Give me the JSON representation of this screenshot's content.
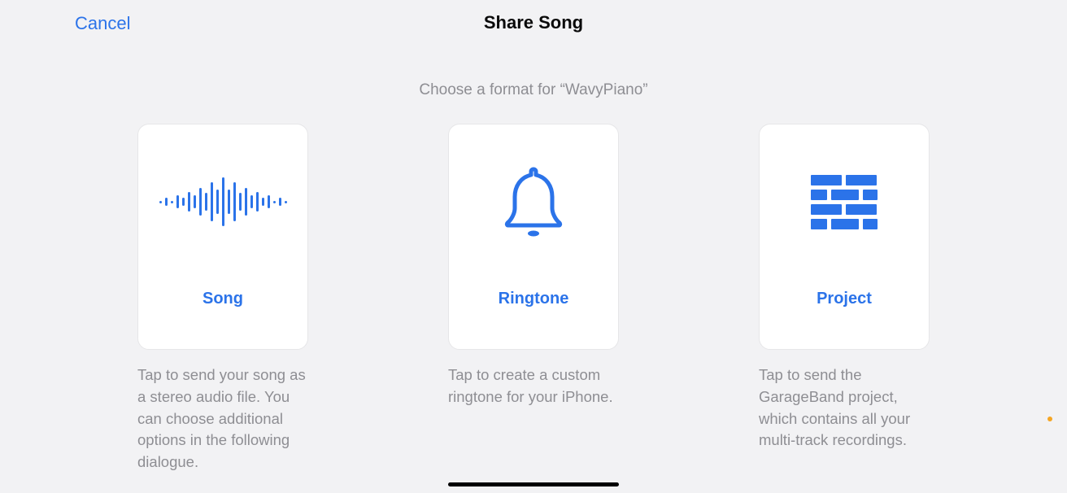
{
  "header": {
    "cancel_label": "Cancel",
    "title": "Share Song"
  },
  "subtitle": "Choose a format for “WavyPiano”",
  "options": {
    "song": {
      "label": "Song",
      "description": "Tap to send your song as a stereo audio file. You can choose additional options in the following dialogue."
    },
    "ringtone": {
      "label": "Ringtone",
      "description": "Tap to create a custom ringtone for your iPhone."
    },
    "project": {
      "label": "Project",
      "description": "Tap to send the GarageBand project, which contains all your multi-track recordings."
    }
  },
  "colors": {
    "accent": "#2b73e9",
    "muted": "#8e8e93",
    "card_bg": "#ffffff",
    "page_bg": "#f2f2f4"
  }
}
